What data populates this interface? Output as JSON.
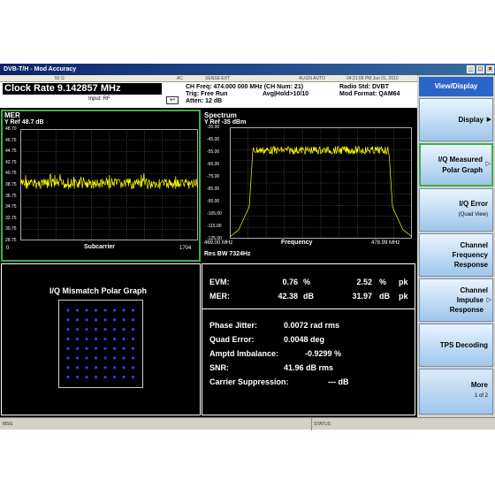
{
  "window": {
    "title": "DVB-T/H - Mod Accuracy"
  },
  "strip": {
    "items": [
      "50 Ω",
      "AC",
      "SENSE:EXT",
      "ALIGN AUTO"
    ],
    "datetime": "04:21:09 PM Jun 01, 2010"
  },
  "header": {
    "clock_rate": "Clock Rate  9.142857 MHz",
    "input": "Input: RF",
    "ch_freq": "CH Freq: 474.000 000 MHz (CH Num: 21)",
    "trig": "Trig: Free Run",
    "avg_hold": "Avg|Hold>10/10",
    "atten": "Atten: 12 dB",
    "radio_std": "Radio Std: DVBT",
    "mod_format": "Mod Format: QAM64"
  },
  "mer_panel": {
    "title": "MER",
    "yref": "Y Ref  48.7 dB",
    "y_ticks": [
      "48.70",
      "46.75",
      "44.75",
      "42.75",
      "40.75",
      "38.75",
      "36.75",
      "34.75",
      "32.75",
      "30.75",
      "28.75"
    ],
    "x_start": "0",
    "x_label": "Subcarrier",
    "x_end": "1704",
    "trace_color": "#ffff00"
  },
  "spectrum_panel": {
    "title": "Spectrum",
    "yref": "Y Ref  -35 dBm",
    "y_ticks": [
      "-35.00",
      "-45.00",
      "-55.00",
      "-65.00",
      "-75.00",
      "-85.00",
      "-95.00",
      "-105.00",
      "-115.00",
      "-125.00"
    ],
    "x_start": "469.00 MHz",
    "x_label": "Frequency",
    "x_end": "478.99 MHz",
    "res_bw": "Res BW 7324Hz",
    "trace_color": "#ffff00"
  },
  "polar_panel": {
    "title": "I/Q Mismatch Polar Graph",
    "point_color": "#3a3aff"
  },
  "results": {
    "evm_label": "EVM:",
    "evm_rms": "0.76",
    "evm_rms_unit": "%",
    "evm_pk": "2.52",
    "evm_pk_unit": "%",
    "evm_pk_suffix": "pk",
    "mer_label": "MER:",
    "mer_rms": "42.38",
    "mer_rms_unit": "dB",
    "mer_pk": "31.97",
    "mer_pk_unit": "dB",
    "mer_pk_suffix": "pk",
    "phase_jitter_label": "Phase Jitter:",
    "phase_jitter": "0.0072 rad rms",
    "quad_error_label": "Quad Error:",
    "quad_error": "0.0048 deg",
    "amptd_imbalance_label": "Amptd Imbalance:",
    "amptd_imbalance": "-0.9299 %",
    "snr_label": "SNR:",
    "snr": "41.96 dB rms",
    "carrier_supp_label": "Carrier Suppression:",
    "carrier_supp": "--- dB"
  },
  "softkeys": {
    "title": "View/Display",
    "display": "Display",
    "iq_measured_1": "I/Q Measured",
    "iq_measured_2": "Polar Graph",
    "iq_error_1": "I/Q Error",
    "iq_error_2": "(Quad View)",
    "channel_freq_1": "Channel",
    "channel_freq_2": "Frequency",
    "channel_freq_3": "Response",
    "channel_imp_1": "Channel",
    "channel_imp_2": "Impulse",
    "channel_imp_3": "Response",
    "tps": "TPS Decoding",
    "more": "More",
    "more_page": "1 of 2"
  },
  "statusbar": {
    "msg": "MSG",
    "status": "STATUS"
  }
}
